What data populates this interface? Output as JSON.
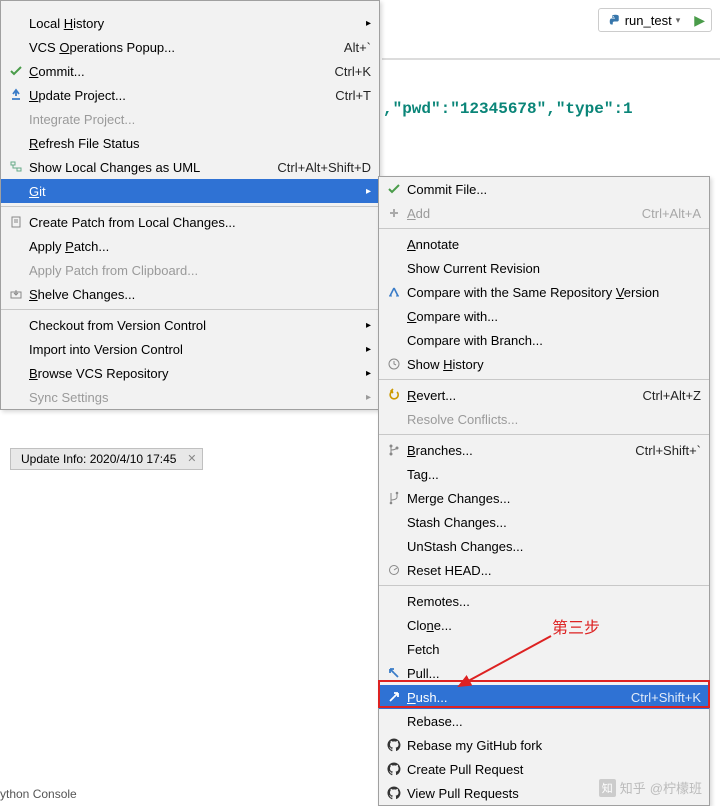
{
  "toolbar": {
    "config": "run_test"
  },
  "editor": {
    "text": ",\"pwd\":\"12345678\",\"type\":1"
  },
  "status": {
    "tab": "Update Info: 2020/4/10 17:45"
  },
  "console": {
    "label": "ython Console"
  },
  "callout": {
    "text": "第三步"
  },
  "watermark": {
    "site": "知乎",
    "user": "@柠檬班"
  },
  "menu1": [
    {
      "label": "Local History",
      "u": "H",
      "arrow": true
    },
    {
      "label": "VCS Operations Popup...",
      "u": "O",
      "shortcut": "Alt+`"
    },
    {
      "label": "Commit...",
      "u": "C",
      "shortcut": "Ctrl+K",
      "icon": "check-green"
    },
    {
      "label": "Update Project...",
      "u": "U",
      "shortcut": "Ctrl+T",
      "icon": "update-blue"
    },
    {
      "label": "Integrate Project...",
      "disabled": true
    },
    {
      "label": "Refresh File Status",
      "u": "R"
    },
    {
      "label": "Show Local Changes as UML",
      "shortcut": "Ctrl+Alt+Shift+D",
      "icon": "uml"
    },
    {
      "label": "Git",
      "u": "G",
      "arrow": true,
      "sel": true
    },
    {
      "sep": true
    },
    {
      "label": "Create Patch from Local Changes...",
      "icon": "patch"
    },
    {
      "label": "Apply Patch...",
      "u": "P"
    },
    {
      "label": "Apply Patch from Clipboard...",
      "disabled": true
    },
    {
      "label": "Shelve Changes...",
      "u": "S",
      "icon": "shelve"
    },
    {
      "sep": true
    },
    {
      "label": "Checkout from Version Control",
      "arrow": true
    },
    {
      "label": "Import into Version Control",
      "arrow": true
    },
    {
      "label": "Browse VCS Repository",
      "u": "B",
      "arrow": true
    },
    {
      "label": "Sync Settings",
      "disabled": true,
      "arrow": true
    }
  ],
  "menu2": [
    {
      "label": "Commit File...",
      "icon": "check-green"
    },
    {
      "label": "Add",
      "u": "A",
      "shortcut": "Ctrl+Alt+A",
      "icon": "plus-gray",
      "disabled": true
    },
    {
      "sep": true
    },
    {
      "label": "Annotate",
      "u": "A"
    },
    {
      "label": "Show Current Revision"
    },
    {
      "label": "Compare with the Same Repository Version",
      "u": "V",
      "icon": "compare"
    },
    {
      "label": "Compare with...",
      "u": "C"
    },
    {
      "label": "Compare with Branch..."
    },
    {
      "label": "Show History",
      "u": "H",
      "icon": "clock"
    },
    {
      "sep": true
    },
    {
      "label": "Revert...",
      "u": "R",
      "shortcut": "Ctrl+Alt+Z",
      "icon": "revert"
    },
    {
      "label": "Resolve Conflicts...",
      "disabled": true
    },
    {
      "sep": true
    },
    {
      "label": "Branches...",
      "u": "B",
      "shortcut": "Ctrl+Shift+`",
      "icon": "branch"
    },
    {
      "label": "Tag..."
    },
    {
      "label": "Merge Changes...",
      "icon": "merge"
    },
    {
      "label": "Stash Changes..."
    },
    {
      "label": "UnStash Changes..."
    },
    {
      "label": "Reset HEAD...",
      "icon": "reset"
    },
    {
      "sep": true
    },
    {
      "label": "Remotes..."
    },
    {
      "label": "Clone...",
      "u": "n"
    },
    {
      "label": "Fetch"
    },
    {
      "label": "Pull...",
      "icon": "pull-blue"
    },
    {
      "label": "Push...",
      "u": "P",
      "shortcut": "Ctrl+Shift+K",
      "icon": "push-green",
      "sel": true
    },
    {
      "label": "Rebase..."
    },
    {
      "label": "Rebase my GitHub fork",
      "icon": "github"
    },
    {
      "label": "Create Pull Request",
      "icon": "github"
    },
    {
      "label": "View Pull Requests",
      "icon": "github"
    }
  ]
}
